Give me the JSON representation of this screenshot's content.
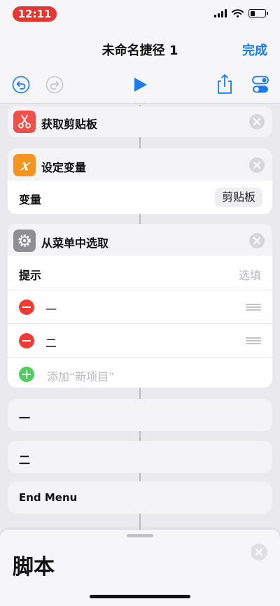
{
  "status_bar": {
    "time": "12:11"
  },
  "nav": {
    "title": "未命名捷径 1",
    "done_label": "完成"
  },
  "toolbar": {
    "icons": [
      "undo-icon",
      "redo-icon",
      "play-icon",
      "share-icon",
      "settings-toggle-icon"
    ]
  },
  "actions": {
    "clipboard": {
      "title": "获取剪贴板",
      "icon": "scissors-icon",
      "color": "#f0504a"
    },
    "set_variable": {
      "title": "设定变量",
      "icon": "variable-x-icon",
      "color": "#f3951f",
      "var_label": "变量",
      "var_value": "剪贴板"
    },
    "choose_menu": {
      "title": "从菜单中选取",
      "icon": "gear-icon",
      "color": "#8e8e93",
      "prompt_label": "提示",
      "prompt_placeholder": "选填",
      "items": [
        "一",
        "二"
      ],
      "add_label": "添加“新项目”"
    },
    "menu_case_1": {
      "label": "一"
    },
    "menu_case_2": {
      "label": "二"
    },
    "end_menu": {
      "label": "End Menu"
    }
  },
  "sheet": {
    "title": "脚本"
  },
  "colors": {
    "accent": "#1a7cf2",
    "delete": "#ef3b33",
    "add": "#52cc60"
  }
}
